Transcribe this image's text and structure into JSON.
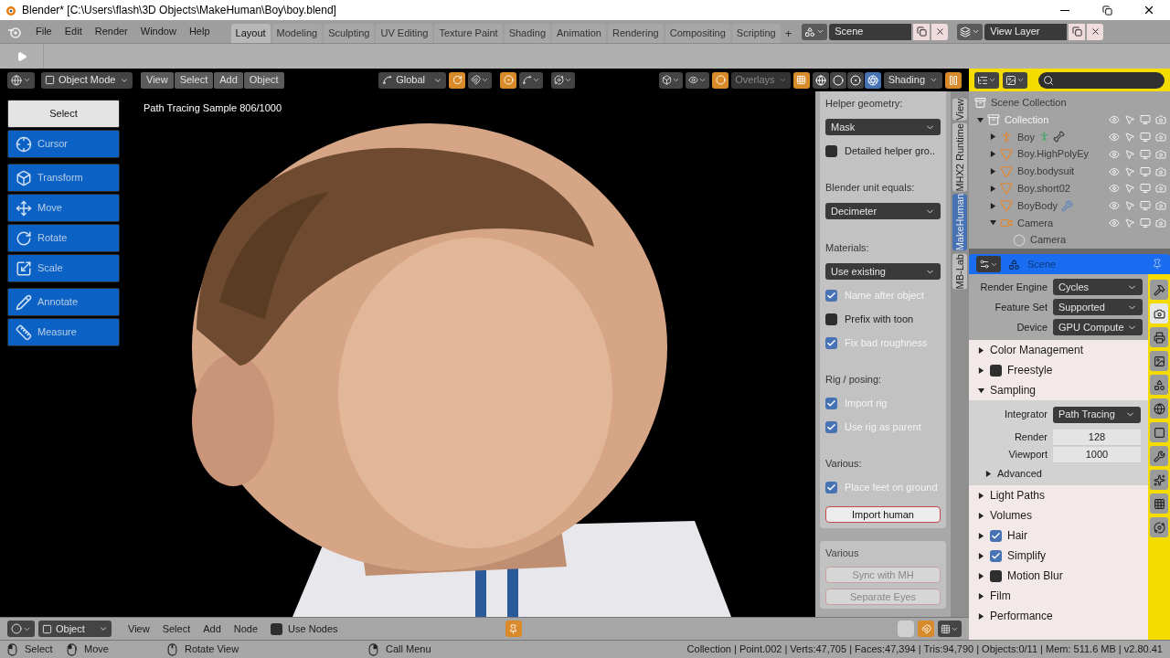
{
  "title_bar": {
    "title": "Blender* [C:\\Users\\flash\\3D Objects\\MakeHuman\\Boy\\boy.blend]"
  },
  "menu": [
    "File",
    "Edit",
    "Render",
    "Window",
    "Help"
  ],
  "workspaces": [
    {
      "label": "Layout",
      "selected": true
    },
    {
      "label": "Modeling",
      "selected": false
    },
    {
      "label": "Sculpting",
      "selected": false
    },
    {
      "label": "UV Editing",
      "selected": false
    },
    {
      "label": "Texture Paint",
      "selected": false
    },
    {
      "label": "Shading",
      "selected": false
    },
    {
      "label": "Animation",
      "selected": false
    },
    {
      "label": "Rendering",
      "selected": false
    },
    {
      "label": "Compositing",
      "selected": false
    },
    {
      "label": "Scripting",
      "selected": false
    }
  ],
  "add_workspace": "+",
  "scene": {
    "name": "Scene"
  },
  "view_layer": {
    "name": "View Layer"
  },
  "viewport": {
    "mode": "Object Mode",
    "menus": [
      "View",
      "Select",
      "Add",
      "Object"
    ],
    "orientation": "Global",
    "overlays": "Overlays",
    "shading": "Shading",
    "shading_modes": [
      {
        "kind": "wireframe",
        "selected": false
      },
      {
        "kind": "solid",
        "selected": false
      },
      {
        "kind": "material",
        "selected": false
      },
      {
        "kind": "rendered",
        "selected": true
      }
    ],
    "render_info": "Path Tracing Sample 806/1000"
  },
  "tool_groups": [
    {
      "tools": [
        {
          "kind": "select",
          "label": "Select",
          "selected": true
        },
        {
          "kind": "cursor",
          "label": "Cursor",
          "selected": false
        }
      ]
    },
    {
      "tools": [
        {
          "kind": "transform",
          "label": "Transform",
          "selected": false
        },
        {
          "kind": "move",
          "label": "Move",
          "selected": false
        },
        {
          "kind": "rotate",
          "label": "Rotate",
          "selected": false
        },
        {
          "kind": "scale",
          "label": "Scale",
          "selected": false
        }
      ]
    },
    {
      "tools": [
        {
          "kind": "annotate",
          "label": "Annotate",
          "selected": false
        },
        {
          "kind": "measure",
          "label": "Measure",
          "selected": false
        }
      ]
    }
  ],
  "n_panel": {
    "items": [
      {
        "kind": "heading",
        "text": "Helper geometry:"
      },
      {
        "kind": "dropdown",
        "value": "Mask"
      },
      {
        "kind": "checkbox",
        "label": "Detailed helper gro..",
        "checked": false
      },
      {
        "kind": "heading",
        "text": "Blender unit equals:"
      },
      {
        "kind": "dropdown",
        "value": "Decimeter"
      },
      {
        "kind": "heading",
        "text": "Materials:"
      },
      {
        "kind": "dropdown",
        "value": "Use existing"
      },
      {
        "kind": "checkbox",
        "label": "Name after object",
        "checked": true
      },
      {
        "kind": "checkbox",
        "label": "Prefix with toon",
        "checked": false
      },
      {
        "kind": "checkbox",
        "label": "Fix bad roughness",
        "checked": true
      },
      {
        "kind": "heading",
        "text": "Rig / posing:"
      },
      {
        "kind": "checkbox",
        "label": "Import rig",
        "checked": true
      },
      {
        "kind": "checkbox",
        "label": "Use rig as parent",
        "checked": true
      },
      {
        "kind": "heading",
        "text": "Various:"
      },
      {
        "kind": "checkbox",
        "label": "Place feet on ground",
        "checked": true
      },
      {
        "kind": "button",
        "label": "Import human"
      }
    ],
    "various": {
      "title": "Various",
      "buttons": [
        {
          "label": "Sync with MH",
          "disabled": true
        },
        {
          "label": "Separate Eyes",
          "disabled": true
        }
      ]
    }
  },
  "sidebar_tabs": [
    {
      "label": "View",
      "selected": false
    },
    {
      "label": "MHX2 Runtime",
      "selected": false
    },
    {
      "label": "MakeHuman",
      "selected": true
    },
    {
      "label": "MB-Lab",
      "selected": false
    }
  ],
  "outliner": {
    "root": "Scene Collection",
    "tree": [
      {
        "name": "Collection",
        "kind": "collection",
        "expanded": true,
        "children": [
          {
            "name": "Boy",
            "kind": "armature",
            "expanded": false,
            "posed": true,
            "modified": false
          },
          {
            "name": "Boy.HighPolyEy",
            "kind": "mesh",
            "expanded": false,
            "posed": false,
            "modified": false
          },
          {
            "name": "Boy.bodysuit",
            "kind": "mesh",
            "expanded": false,
            "posed": false,
            "modified": false
          },
          {
            "name": "Boy.short02",
            "kind": "mesh",
            "expanded": false,
            "posed": false,
            "modified": false
          },
          {
            "name": "BoyBody",
            "kind": "mesh",
            "expanded": false,
            "posed": false,
            "modified": true
          },
          {
            "name": "Camera",
            "kind": "camera",
            "expanded": true,
            "posed": false,
            "modified": false,
            "children": [
              {
                "name": "Camera",
                "kind": "camera_data"
              }
            ]
          }
        ]
      }
    ]
  },
  "properties": {
    "context": "Scene",
    "engine_rows": [
      {
        "label": "Render Engine",
        "value": "Cycles"
      },
      {
        "label": "Feature Set",
        "value": "Supported"
      },
      {
        "label": "Device",
        "value": "GPU Compute"
      }
    ],
    "panels": [
      {
        "title": "Color Management",
        "expanded": false
      },
      {
        "title": "Freestyle",
        "expanded": false,
        "checked": false
      },
      {
        "title": "Sampling",
        "expanded": true,
        "fields": [
          {
            "kind": "dropdown",
            "label": "Integrator",
            "value": "Path Tracing"
          },
          {
            "kind": "number",
            "label": "Render",
            "value": "128"
          },
          {
            "kind": "number",
            "label": "Viewport",
            "value": "1000"
          }
        ],
        "subpanels": [
          {
            "title": "Advanced",
            "expanded": false
          }
        ]
      },
      {
        "title": "Light Paths",
        "expanded": false
      },
      {
        "title": "Volumes",
        "expanded": false
      },
      {
        "title": "Hair",
        "expanded": false,
        "checked": true
      },
      {
        "title": "Simplify",
        "expanded": false,
        "checked": true
      },
      {
        "title": "Motion Blur",
        "expanded": false,
        "checked": false
      },
      {
        "title": "Film",
        "expanded": false
      },
      {
        "title": "Performance",
        "expanded": false
      }
    ],
    "tabs": [
      {
        "kind": "tool",
        "selected": false
      },
      {
        "kind": "render",
        "selected": true
      },
      {
        "kind": "output",
        "selected": false
      },
      {
        "kind": "view_layer",
        "selected": false
      },
      {
        "kind": "scene",
        "selected": false
      },
      {
        "kind": "world",
        "selected": false
      },
      {
        "kind": "object",
        "selected": false
      },
      {
        "kind": "modifiers",
        "selected": false
      },
      {
        "kind": "particles",
        "selected": false
      },
      {
        "kind": "texture",
        "selected": false
      },
      {
        "kind": "physics",
        "selected": false
      }
    ]
  },
  "editor_header": {
    "mode": "Object",
    "menus": [
      "View",
      "Select",
      "Add",
      "Node"
    ],
    "use_nodes": {
      "label": "Use Nodes",
      "checked": false
    }
  },
  "status_bar": {
    "hints": [
      {
        "kind": "left",
        "label": "Select"
      },
      {
        "kind": "drag",
        "label": "Move"
      },
      {
        "kind": "middle",
        "label": "Rotate View"
      },
      {
        "kind": "right",
        "label": "Call Menu"
      }
    ],
    "stats": "Collection | Point.002 | Verts:47,705 | Faces:47,394 | Tris:94,790 | Objects:0/11 | Mem: 511.6 MB | v2.80.41"
  }
}
